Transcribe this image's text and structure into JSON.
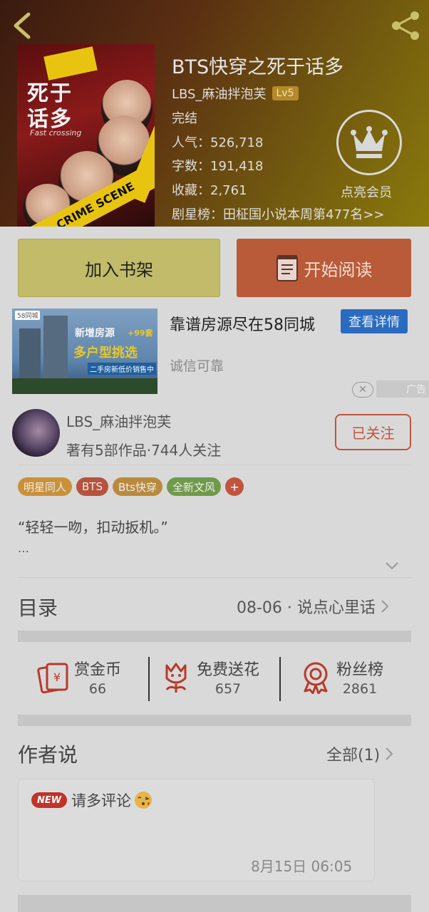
{
  "book": {
    "title": "BTS快穿之死于话多",
    "author": "LBS_麻油拌泡芙",
    "level": "Lv5",
    "status": "完结",
    "popularity": "人气：526,718",
    "word_count": "字数：191,418",
    "favorites": "收藏：2,761",
    "ranking": "剧星榜：田柾国小说本周第477名>>",
    "member_label": "点亮会员",
    "cover_title": "死于话多",
    "cover_subtitle": "Fast crossing",
    "cover_tape": "CRIME SCENE"
  },
  "actions": {
    "shelf_label": "加入书架",
    "read_label": "开始阅读"
  },
  "ad": {
    "title": "靠谱房源尽在58同城",
    "button": "查看详情",
    "subtitle": "诚信可靠",
    "mark": "广告",
    "close": "✕",
    "image_tag": "58同城",
    "image_line1": "新增房源",
    "image_plus": "+99套",
    "image_line2": "多户型挑选",
    "image_line3": "二手房新低价销售中"
  },
  "author_info": {
    "name": "LBS_麻油拌泡芙",
    "stats": "著有5部作品·744人关注",
    "follow_label": "已关注"
  },
  "tags": [
    {
      "label": "明星同人",
      "color": "#c9913a"
    },
    {
      "label": "BTS",
      "color": "#b5533e"
    },
    {
      "label": "Bts快穿",
      "color": "#b98a3e"
    },
    {
      "label": "全新文风",
      "color": "#6f9a4a"
    }
  ],
  "tag_more": "+",
  "summary": {
    "quote": "“轻轻一吻，扣动扳机。”",
    "ellipsis": "…"
  },
  "toc": {
    "label": "目录",
    "latest": "08-06 · 说点心里话"
  },
  "stats": [
    {
      "label": "赏金币",
      "value": "66",
      "icon": "coin-envelope-icon"
    },
    {
      "label": "免费送花",
      "value": "657",
      "icon": "flower-icon"
    },
    {
      "label": "粉丝榜",
      "value": "2861",
      "icon": "medal-icon"
    }
  ],
  "author_says": {
    "label": "作者说",
    "all": "全部(1)",
    "badge": "NEW",
    "comment": "请多评论",
    "time": "8月15日  06:05"
  },
  "colors": {
    "accent_red": "#c0553f",
    "shelf_yellow": "#c2bb6a",
    "ad_blue": "#2a6bbf"
  }
}
